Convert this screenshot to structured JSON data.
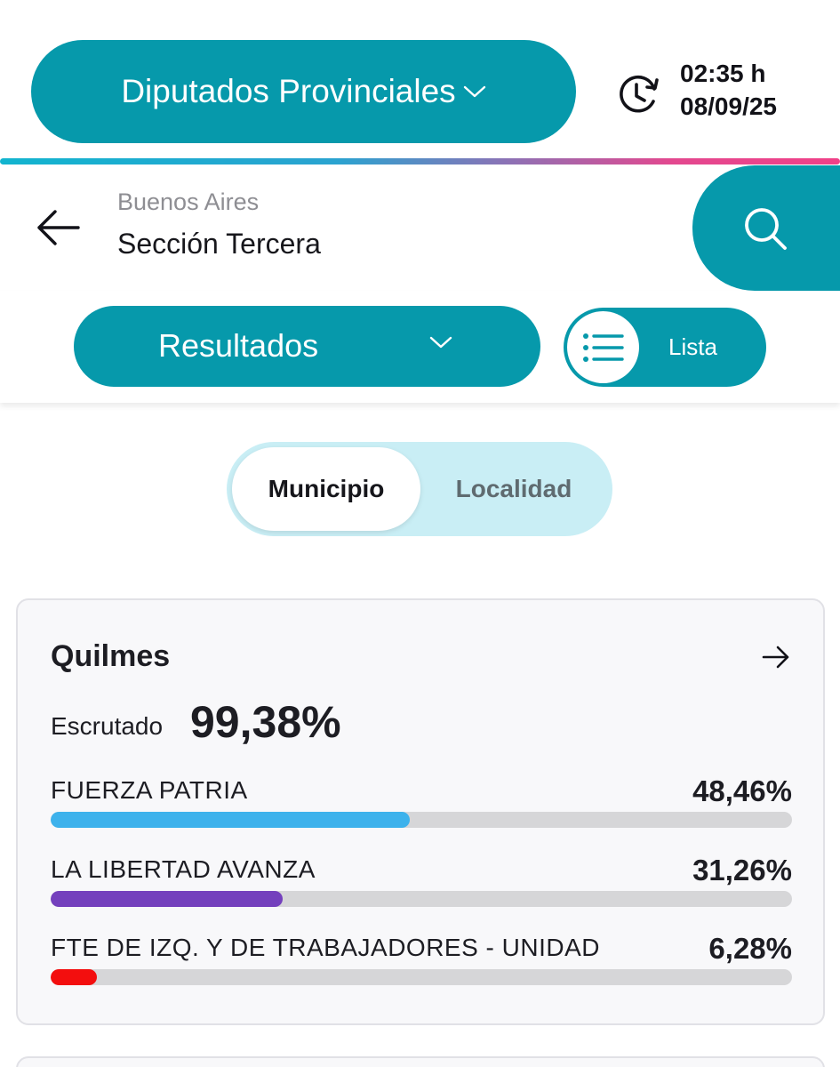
{
  "header": {
    "election_selector": "Diputados Provinciales",
    "updated_time": "02:35 h",
    "updated_date": "08/09/25"
  },
  "location": {
    "province": "Buenos Aires",
    "section": "Sección Tercera"
  },
  "controls": {
    "results_dropdown": "Resultados",
    "view_toggle": "Lista"
  },
  "segmented": {
    "tabs": [
      "Municipio",
      "Localidad"
    ],
    "selected": "Municipio"
  },
  "card": {
    "title": "Quilmes",
    "scrutiny_label": "Escrutado",
    "scrutiny_value": "99,38%",
    "parties": [
      {
        "name": "FUERZA PATRIA",
        "percent_label": "48,46%",
        "percent": 48.46,
        "color": "#3db2ec"
      },
      {
        "name": "LA LIBERTAD AVANZA",
        "percent_label": "31,26%",
        "percent": 31.26,
        "color": "#7440bd"
      },
      {
        "name": "FTE DE IZQ. Y DE TRABAJADORES - UNIDAD",
        "percent_label": "6,28%",
        "percent": 6.28,
        "color": "#f30e0e"
      }
    ]
  },
  "colors": {
    "accent": "#0699ab",
    "toggle_track": "#c9eef5",
    "bar_track": "#d6d6d8"
  },
  "icons": {
    "election_chevron": "chevron-down-icon",
    "clock": "clock-history-icon",
    "back": "arrow-left-icon",
    "search": "search-icon",
    "list": "list-icon",
    "card_arrow": "arrow-right-icon"
  }
}
